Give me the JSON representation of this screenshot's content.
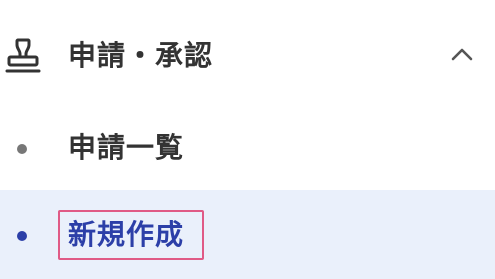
{
  "section": {
    "title": "申請・承認",
    "icon": "stamp-icon",
    "expand_icon": "chevron-up-icon",
    "expanded": true
  },
  "items": [
    {
      "label": "申請一覧",
      "active": false
    },
    {
      "label": "新規作成",
      "active": true
    }
  ],
  "colors": {
    "text": "#333333",
    "active_text": "#2c3fa8",
    "active_background": "#eaf0fb",
    "inactive_bullet": "#777777",
    "active_bullet": "#2c3fa8",
    "focus_outline": "#e05a86"
  }
}
